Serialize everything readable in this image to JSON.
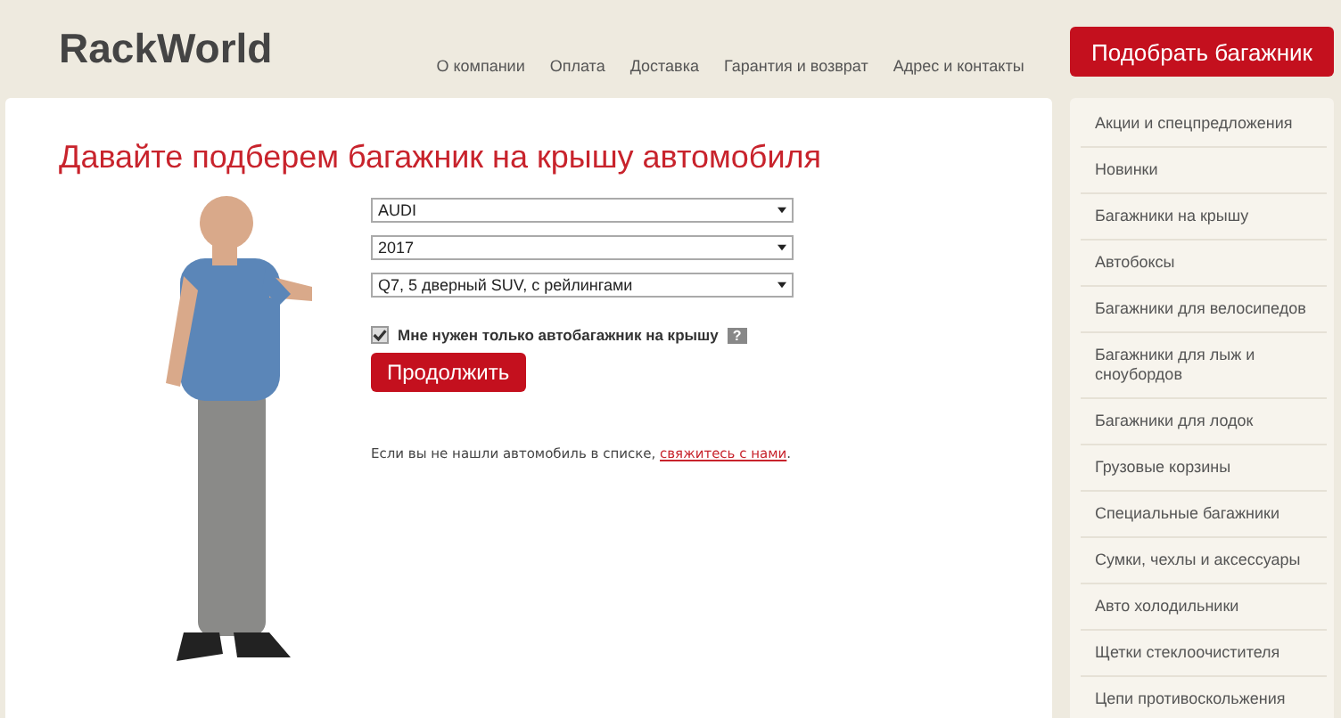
{
  "header": {
    "logo": "RackWorld",
    "nav": [
      "О компании",
      "Оплата",
      "Доставка",
      "Гарантия и возврат",
      "Адрес и контакты"
    ],
    "cta": "Подобрать багажник"
  },
  "main": {
    "title": "Давайте подберем багажник на крышу автомобиля",
    "selects": [
      {
        "value": "AUDI"
      },
      {
        "value": "2017"
      },
      {
        "value": "Q7, 5 дверный SUV, с рейлингами"
      }
    ],
    "checkbox": {
      "label": "Мне нужен только автобагажник на крышу",
      "checked": true,
      "help": "?"
    },
    "button": "Продолжить",
    "note": {
      "text": "Если вы не нашли автомобиль в списке, ",
      "link": "свяжитесь с нами",
      "end": "."
    }
  },
  "sidebar": {
    "items": [
      "Акции и спецпредложения",
      "Новинки",
      "Багажники на крышу",
      "Автобоксы",
      "Багажники для велосипедов",
      "Багажники для лыж и сноубордов",
      "Багажники для лодок",
      "Грузовые корзины",
      "Специальные багажники",
      "Сумки, чехлы и аксессуары",
      "Авто холодильники",
      "Щетки стеклоочистителя",
      "Цепи противоскольжения"
    ]
  }
}
